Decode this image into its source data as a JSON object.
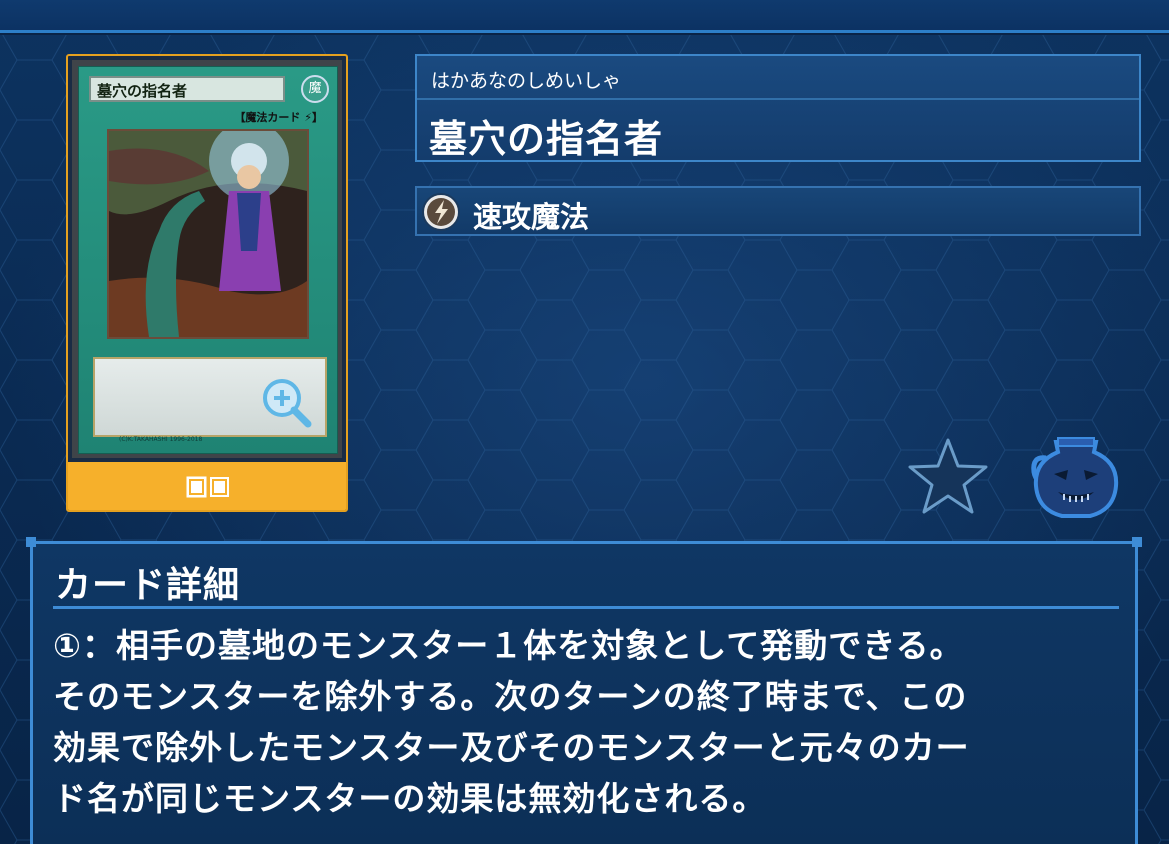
{
  "card": {
    "ruby": "はかあなのしめいしゃ",
    "name": "墓穴の指名者",
    "type": "速攻魔法",
    "face": {
      "title": "墓穴の指名者",
      "attribute": "魔",
      "type_line": "【魔法カード ⚡】",
      "footer": "(C)K.TAKAHASHI  1996-2018"
    }
  },
  "detail": {
    "heading": "カード詳細",
    "lines": [
      "①：相手の墓地のモンスター１体を対象として発動できる。",
      "そのモンスターを除外する。次のターンの終了時まで、この",
      "効果で除外したモンスター及びそのモンスターと元々のカー",
      "ド名が同じモンスターの効果は無効化される。"
    ]
  },
  "icons": {
    "quickplay": "quick-play-spell-icon",
    "zoom": "zoom-in-icon",
    "cards": "card-count-icon",
    "favorite": "star-icon",
    "pot": "pot-icon"
  },
  "colors": {
    "accent": "#3e8cd6",
    "card_frame": "#f6b02b",
    "spell_green": "#2a9a86",
    "background": "#0b2a4f"
  }
}
